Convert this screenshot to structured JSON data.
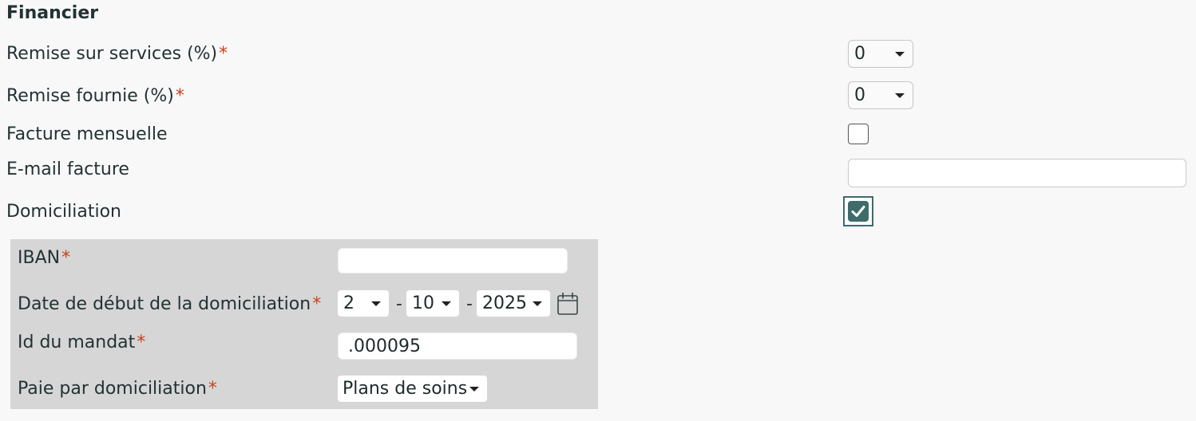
{
  "section": {
    "title": "Financier"
  },
  "fields": {
    "remise_services": {
      "label": "Remise sur services (%)",
      "required_mark": "*",
      "value": "0"
    },
    "remise_fournie": {
      "label": "Remise fournie (%)",
      "required_mark": "*",
      "value": "0"
    },
    "facture_mensuelle": {
      "label": "Facture mensuelle",
      "checked": false
    },
    "email_facture": {
      "label": "E-mail facture",
      "value": ""
    },
    "domiciliation": {
      "label": "Domiciliation",
      "checked": true
    }
  },
  "domiciliation_panel": {
    "iban": {
      "label": "IBAN",
      "required_mark": "*",
      "value": ""
    },
    "date_debut": {
      "label": "Date de début de la domiciliation",
      "required_mark": "*",
      "day": "2",
      "month": "10",
      "year": "2025",
      "separator": "-",
      "icon": "calendar-icon"
    },
    "id_mandat": {
      "label": "Id du mandat",
      "required_mark": "*",
      "value": ".000095"
    },
    "paie_domiciliation": {
      "label": "Paie par domiciliation",
      "required_mark": "*",
      "value": "Plans de soins"
    }
  },
  "colors": {
    "required": "#c8421c",
    "accent": "#3e6c6b",
    "panel_bg": "#d6d6d6",
    "page_bg": "#f8f8f8"
  }
}
